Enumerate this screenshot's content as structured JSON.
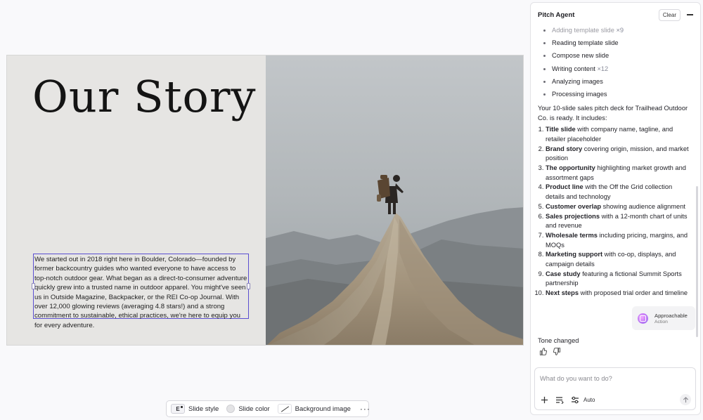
{
  "slide": {
    "title": "Our Story",
    "body": "We started out in 2018 right here in Boulder, Colorado—founded by former backcountry guides who wanted everyone to have access to top-notch outdoor gear. What began as a direct-to-consumer adventure quickly grew into a trusted name in outdoor apparel. You might've seen us in Outside Magazine, Backpacker, or the REI Co-op Journal. With over 12,000 glowing reviews (averaging 4.8 stars!) and a strong commitment to sustainable, ethical practices, we're here to equip you for every adventure."
  },
  "toolbar": {
    "slide_style_icon": "E",
    "slide_style": "Slide style",
    "slide_color": "Slide color",
    "background_image": "Background image",
    "more": "···"
  },
  "panel": {
    "title": "Pitch Agent",
    "clear": "Clear",
    "steps": [
      {
        "label": "Adding template slide",
        "count": "×9"
      },
      {
        "label": "Reading template slide",
        "count": ""
      },
      {
        "label": "Compose new slide",
        "count": ""
      },
      {
        "label": "Writing content",
        "count": "×12"
      },
      {
        "label": "Analyzing images",
        "count": ""
      },
      {
        "label": "Processing images",
        "count": ""
      }
    ],
    "intro": "Your 10-slide sales pitch deck for Trailhead Outdoor Co. is ready. It includes:",
    "deck": [
      {
        "bold": "Title slide",
        "rest": " with company name, tagline, and retailer placeholder"
      },
      {
        "bold": "Brand story",
        "rest": " covering origin, mission, and market position"
      },
      {
        "bold": "The opportunity",
        "rest": " highlighting market growth and assortment gaps"
      },
      {
        "bold": "Product line",
        "rest": " with the Off the Grid collection details and technology"
      },
      {
        "bold": "Customer overlap",
        "rest": " showing audience alignment"
      },
      {
        "bold": "Sales projections",
        "rest": " with a 12-month chart of units and revenue"
      },
      {
        "bold": "Wholesale terms",
        "rest": " including pricing, margins, and MOQs"
      },
      {
        "bold": "Marketing support",
        "rest": " with co-op, displays, and campaign details"
      },
      {
        "bold": "Case study",
        "rest": " featuring a fictional Summit Sports partnership"
      },
      {
        "bold": "Next steps",
        "rest": " with proposed trial order and timeline"
      }
    ],
    "action": {
      "title": "Approachable",
      "sub": "Action"
    },
    "tone": "Tone changed",
    "composer": {
      "placeholder": "What do you want to do?",
      "mode": "Auto"
    }
  }
}
